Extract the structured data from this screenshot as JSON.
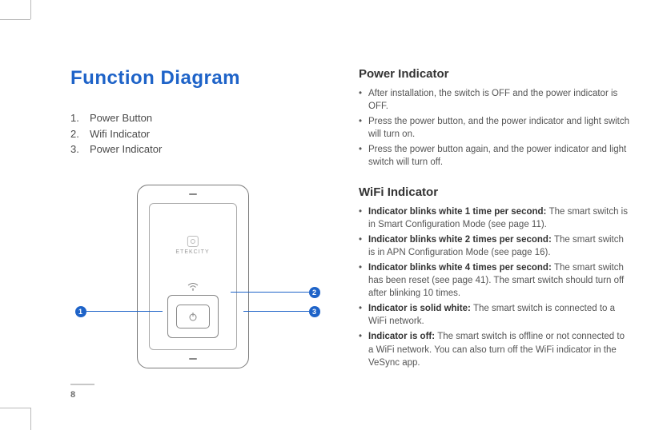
{
  "page_number": "8",
  "left": {
    "title": "Function Diagram",
    "legend": [
      {
        "n": "1.",
        "t": "Power Button"
      },
      {
        "n": "2.",
        "t": "Wifi Indicator"
      },
      {
        "n": "3.",
        "t": "Power Indicator"
      }
    ],
    "callouts": {
      "c1": "1",
      "c2": "2",
      "c3": "3"
    },
    "brand": "ETEKCITY"
  },
  "right": {
    "s1": {
      "h": "Power Indicator",
      "items": [
        {
          "b": "",
          "t": "After installation, the switch is OFF and the power indicator is OFF."
        },
        {
          "b": "",
          "t": "Press the power button, and the power indicator and light switch will turn on."
        },
        {
          "b": "",
          "t": "Press the power button again, and the power indicator and light switch will turn off."
        }
      ]
    },
    "s2": {
      "h": "WiFi Indicator",
      "items": [
        {
          "b": "Indicator blinks white 1 time per second: ",
          "t": "The smart switch is in Smart Configuration Mode (see page 11)."
        },
        {
          "b": "Indicator blinks white 2 times per second: ",
          "t": "The smart switch is in APN Configuration Mode (see page 16)."
        },
        {
          "b": "Indicator blinks white 4 times per second: ",
          "t": "The smart switch has been reset (see page 41). The smart switch should turn off after blinking 10 times."
        },
        {
          "b": "Indicator is solid white: ",
          "t": "The smart switch is connected to a WiFi network."
        },
        {
          "b": "Indicator is off: ",
          "t": "The smart switch is offline or not connected to a WiFi network. You can also turn off the WiFi indicator in the VeSync app."
        }
      ]
    }
  }
}
